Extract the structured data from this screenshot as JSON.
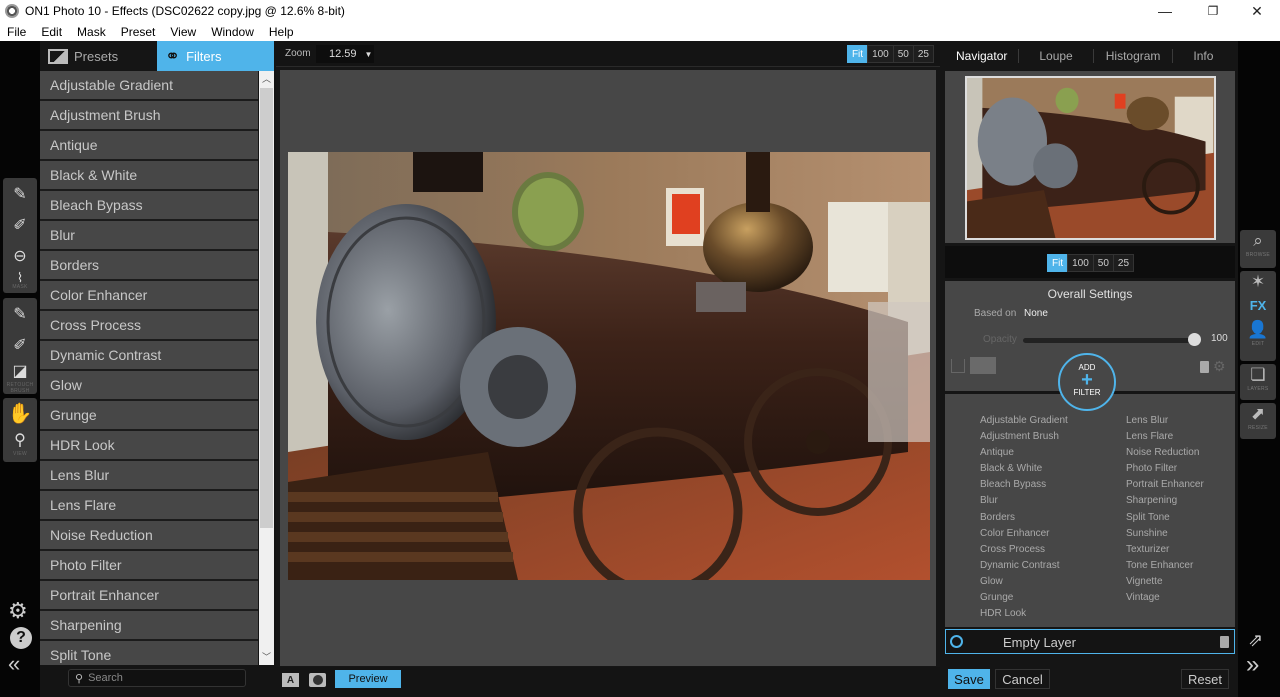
{
  "window": {
    "title": "ON1 Photo 10 - Effects (DSC02622 copy.jpg @ 12.6% 8-bit)",
    "controls": {
      "minimize": "—",
      "restore": "❐",
      "close": "✕"
    }
  },
  "menu": [
    "File",
    "Edit",
    "Mask",
    "Preset",
    "View",
    "Window",
    "Help"
  ],
  "left_tools": {
    "mask_group_label": "MASK",
    "retouch_group_label": "RETOUCH BRUSH",
    "view_group_label": "VIEW",
    "icons": [
      "masking-brush-icon",
      "masking-bug-icon",
      "line-mask-icon",
      "chisel-mask-icon",
      "refine-brush-icon",
      "retouch-brush-icon",
      "perfect-eraser-icon",
      "hand-icon",
      "zoom-icon"
    ]
  },
  "browser_panel": {
    "tabs": [
      {
        "label": "Presets",
        "icon": "image-icon",
        "active": false
      },
      {
        "label": "Filters",
        "icon": "filters-icon",
        "active": true
      }
    ],
    "filters": [
      "Adjustable Gradient",
      "Adjustment Brush",
      "Antique",
      "Black & White",
      "Bleach Bypass",
      "Blur",
      "Borders",
      "Color Enhancer",
      "Cross Process",
      "Dynamic Contrast",
      "Glow",
      "Grunge",
      "HDR Look",
      "Lens Blur",
      "Lens Flare",
      "Noise Reduction",
      "Photo Filter",
      "Portrait Enhancer",
      "Sharpening",
      "Split Tone"
    ],
    "search_placeholder": "Search"
  },
  "canvas": {
    "zoom_label": "Zoom",
    "zoom_value": "12.59",
    "zoom_buttons": [
      "Fit",
      "100",
      "50",
      "25"
    ],
    "active_zoom": "Fit",
    "preview_label": "Preview",
    "compare_icon": "A",
    "photo_description": "Vintage steam locomotive in museum hall"
  },
  "right_panel": {
    "nav_tabs": [
      "Navigator",
      "Loupe",
      "Histogram",
      "Info"
    ],
    "active_nav_tab": "Navigator",
    "nav_zoom_buttons": [
      "Fit",
      "100",
      "50",
      "25"
    ],
    "overall_settings": {
      "title": "Overall Settings",
      "based_on_label": "Based on",
      "based_on_value": "None",
      "opacity_label": "Opacity",
      "opacity_value": "100"
    },
    "add_filter": {
      "top": "ADD",
      "plus": "+",
      "bottom": "FILTER"
    },
    "filter_columns": [
      [
        "Adjustable Gradient",
        "Adjustment Brush",
        "Antique",
        "Black & White",
        "Bleach Bypass",
        "Blur",
        "Borders",
        "Color Enhancer",
        "Cross Process",
        "Dynamic Contrast",
        "Glow",
        "Grunge",
        "HDR Look"
      ],
      [
        "Lens Blur",
        "Lens Flare",
        "Noise Reduction",
        "Photo Filter",
        "Portrait Enhancer",
        "Sharpening",
        "Split Tone",
        "Sunshine",
        "Texturizer",
        "Tone Enhancer",
        "Vignette",
        "Vintage"
      ]
    ],
    "layer_name": "Empty Layer",
    "buttons": {
      "save": "Save",
      "cancel": "Cancel",
      "reset": "Reset"
    }
  },
  "modules": [
    {
      "label": "BROWSE",
      "glyph": "⌕"
    },
    {
      "label": "",
      "glyph": "✶"
    },
    {
      "label": "",
      "glyph": "FX"
    },
    {
      "label": "EDIT",
      "glyph": "👤"
    },
    {
      "label": "LAYERS",
      "glyph": "❏"
    },
    {
      "label": "RESIZE",
      "glyph": "⬈"
    }
  ],
  "colors": {
    "accent": "#4fb4ea",
    "panel": "#474747",
    "background": "#151515"
  }
}
